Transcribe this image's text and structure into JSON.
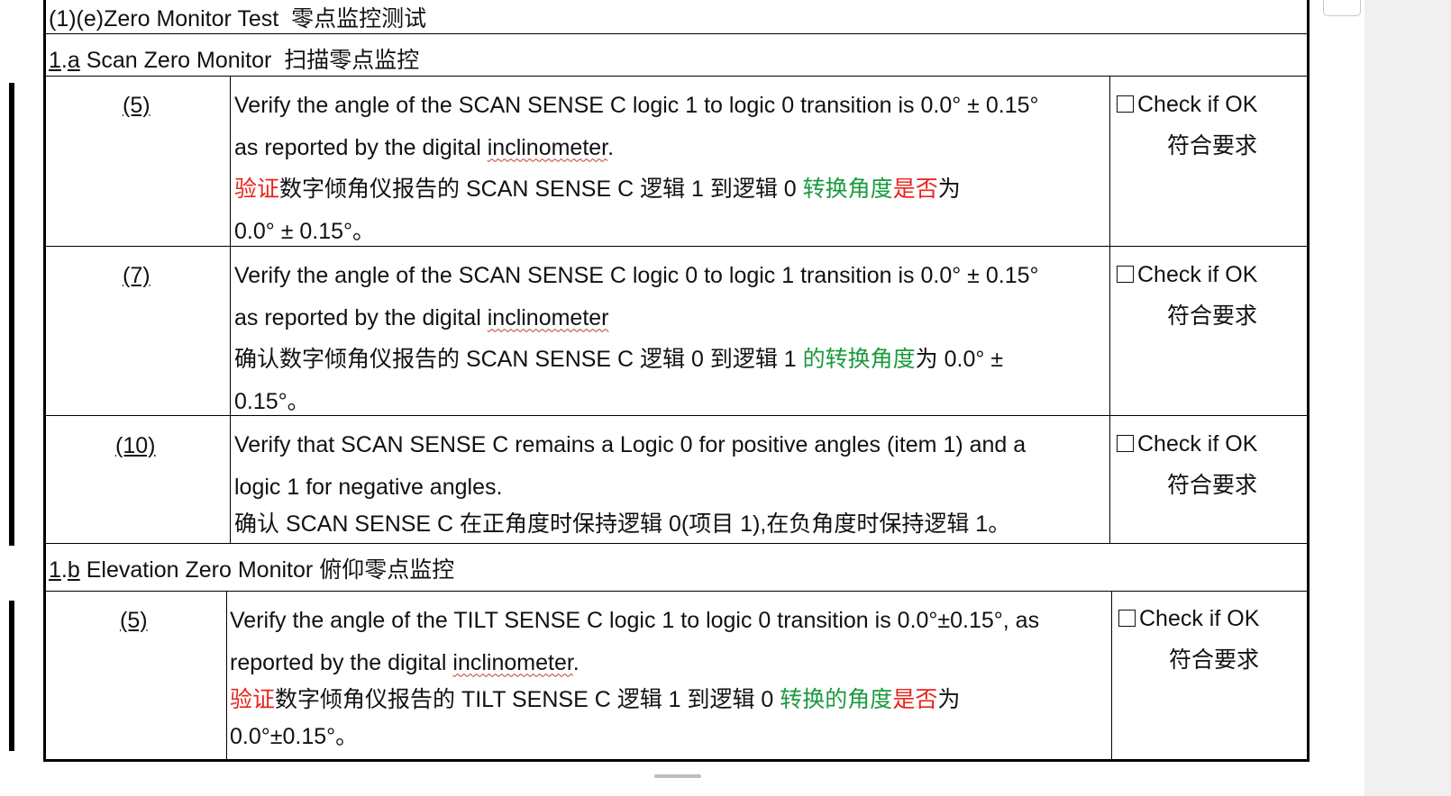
{
  "section": {
    "title": "(1)(e)Zero Monitor Test",
    "title_cn": "零点监控测试"
  },
  "sub_a": {
    "num": "1",
    "letter": "a",
    "title": "Scan Zero Monitor",
    "title_cn": "扫描零点监控"
  },
  "sub_b": {
    "num": "1",
    "letter": "b",
    "title": "Elevation Zero Monitor",
    "title_cn": "俯仰零点监控"
  },
  "check": {
    "en": "Check if OK",
    "cn": "符合要求"
  },
  "rows": [
    {
      "num": "(5)",
      "en1": "Verify the angle of the SCAN SENSE C logic 1 to logic 0 transition is 0.0° ± 0.15°",
      "en2a": "as reported by the digital ",
      "en2b": "inclinometer",
      "en2c": ".",
      "cn_red": "验证",
      "cn_black": "数字倾角仪报告的 SCAN SENSE C 逻辑 1 到逻辑 0 ",
      "cn_green": "转换角度",
      "cn_red2": "是否",
      "cn_black2": "为",
      "cn_line2": "0.0° ± 0.15°。"
    },
    {
      "num": "(7)",
      "en1": "Verify the angle of the SCAN SENSE C logic 0 to logic 1 transition is 0.0° ± 0.15°",
      "en2a": "as reported by the digital ",
      "en2b": "inclinometer",
      "cn_black": "确认数字倾角仪报告的 SCAN SENSE C 逻辑 0 到逻辑 1 ",
      "cn_green": "的转换角度",
      "cn_black2": "为 0.0° ±",
      "cn_line2": "0.15°。"
    },
    {
      "num": "(10)",
      "en1": "Verify that SCAN SENSE C remains a Logic 0 for positive angles (item 1) and a",
      "en2": "logic 1 for negative angles.",
      "cn": "确认 SCAN SENSE C 在正角度时保持逻辑 0(项目 1),在负角度时保持逻辑 1。"
    },
    {
      "num": "(5)",
      "en1": "Verify the angle of the TILT SENSE C logic 1 to logic 0 transition is 0.0°±0.15°, as",
      "en2a": "reported by the digital ",
      "en2b": "inclinometer",
      "en2c": ".",
      "cn_red": "验证",
      "cn_black": "数字倾角仪报告的 TILT SENSE C 逻辑 1 到逻辑 0 ",
      "cn_green": "转换的角度",
      "cn_red2": "是否",
      "cn_black2": "为",
      "cn_line2": "0.0°±0.15°。"
    }
  ]
}
